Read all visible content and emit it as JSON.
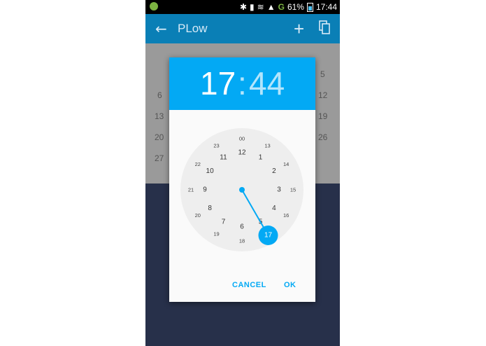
{
  "status_bar": {
    "battery": "61%",
    "time": "17:44",
    "network": "G"
  },
  "app_bar": {
    "title": "PLow",
    "back_icon": "arrow-back-icon",
    "add_icon": "plus-icon",
    "copy_icon": "copy-icon"
  },
  "calendar_days": [
    "5",
    "6",
    "12",
    "13",
    "19",
    "20",
    "26",
    "27"
  ],
  "time_picker": {
    "hour": "17",
    "separator": ":",
    "minute": "44",
    "outer_hours": [
      "12",
      "1",
      "2",
      "3",
      "4",
      "5",
      "6",
      "7",
      "8",
      "9",
      "10",
      "11"
    ],
    "inner_hours": [
      "00",
      "13",
      "14",
      "15",
      "16",
      "17",
      "18",
      "19",
      "20",
      "21",
      "22",
      "23"
    ],
    "selected_hour": "17",
    "cancel_label": "CANCEL",
    "ok_label": "OK"
  },
  "colors": {
    "accent": "#03a9f4",
    "app_bar": "#0a7fb6",
    "background": "#27304a"
  }
}
